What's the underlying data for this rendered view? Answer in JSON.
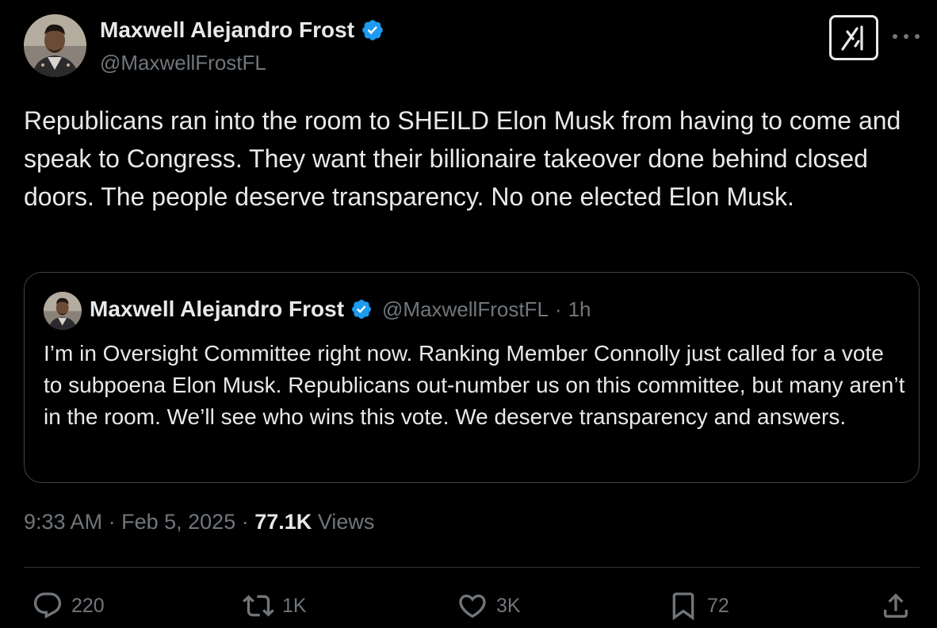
{
  "tweet": {
    "author": {
      "name": "Maxwell Alejandro Frost",
      "handle": "@MaxwellFrostFL",
      "verified_color": "#1d9bf0"
    },
    "text": "Republicans ran into the room to SHEILD Elon Musk from having to come and speak to Congress. They want their billionaire takeover done behind closed doors. The people deserve transparency. No one elected Elon Musk.",
    "quoted": {
      "name": "Maxwell Alejandro Frost",
      "handle": "@MaxwellFrostFL",
      "separator": "·",
      "time_ago": "1h",
      "text": "I’m in Oversight Committee right now. Ranking Member Connolly just called for a vote to subpoena Elon Musk. Republicans out-number us on this committee, but many aren’t in the room. We’ll see who wins this vote. We deserve transparency and answers."
    },
    "meta": {
      "time": "9:33 AM",
      "sep1": "·",
      "date": "Feb 5, 2025",
      "sep2": "·",
      "views_count": "77.1K",
      "views_label": "Views"
    },
    "actions": {
      "replies": "220",
      "reposts": "1K",
      "likes": "3K",
      "bookmarks": "72"
    },
    "icons": {
      "grok": "grok-icon",
      "more": "more-icon",
      "reply": "reply-icon",
      "repost": "repost-icon",
      "like": "heart-icon",
      "bookmark": "bookmark-icon",
      "share": "share-icon",
      "verified": "verified-badge-icon"
    }
  }
}
